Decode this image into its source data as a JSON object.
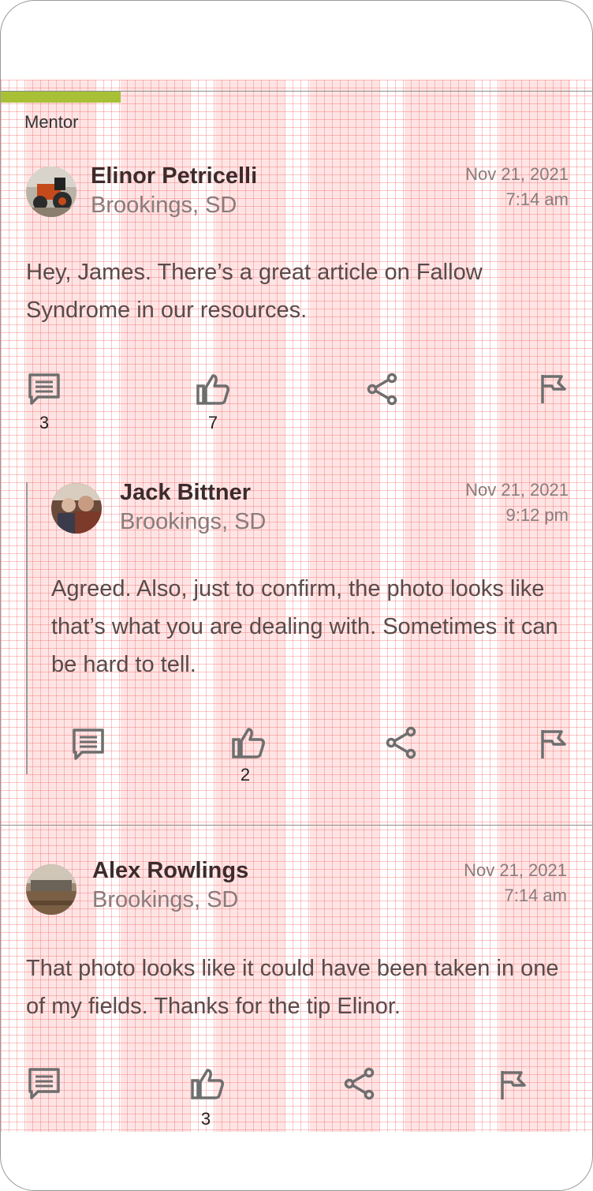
{
  "colors": {
    "accent": "#a8c035",
    "icon": "#6e6e6e"
  },
  "badge": {
    "label": "Mentor"
  },
  "posts": [
    {
      "name": "Elinor Petricelli",
      "location": "Brookings, SD",
      "date": "Nov 21, 2021",
      "time": "7:14 am",
      "text": "Hey, James. There’s a great article on Fallow Syndrome in our resources.",
      "avatar_icon": "tractor-photo",
      "comments": "3",
      "likes": "7"
    },
    {
      "name": "Jack Bittner",
      "location": "Brookings, SD",
      "date": "Nov 21, 2021",
      "time": "9:12 pm",
      "text": "Agreed. Also, just to confirm, the photo looks like that’s what you are dealing with. Sometimes it can be hard to tell.",
      "avatar_icon": "people-photo",
      "likes": "2"
    },
    {
      "name": "Alex Rowlings",
      "location": "Brookings, SD",
      "date": "Nov 21, 2021",
      "time": "7:14 am",
      "text": "That photo looks like it could have been taken in one of my fields. Thanks for the tip Elinor.",
      "avatar_icon": "field-photo",
      "likes": "3"
    }
  ]
}
